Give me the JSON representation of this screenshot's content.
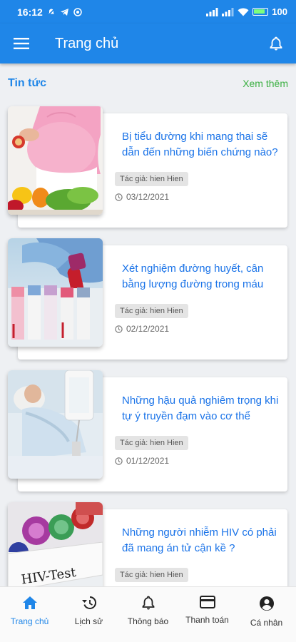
{
  "status_bar": {
    "time": "16:12",
    "battery": "100"
  },
  "app_bar": {
    "title": "Trang chủ"
  },
  "section": {
    "title": "Tin tức",
    "see_more": "Xem thêm"
  },
  "articles": [
    {
      "title": "Bị tiểu đường khi mang thai sẽ dẫn đến những biến chứng nào?",
      "author": "Tác giả: hien Hien",
      "date": "03/12/2021"
    },
    {
      "title": "Xét nghiệm đường huyết, cân bằng lượng đường trong máu",
      "author": "Tác giả: hien Hien",
      "date": "02/12/2021"
    },
    {
      "title": "Những hậu quả nghiêm trọng khi tự ý truyền đạm vào cơ thể",
      "author": "Tác giả: hien Hien",
      "date": "01/12/2021"
    },
    {
      "title": "Những người nhiễm HIV có phải đã mang án tử cận kề ?",
      "author": "Tác giả: hien Hien",
      "date": ""
    }
  ],
  "image_text": {
    "hiv_label": "HIV-Test"
  },
  "bottom_nav": [
    {
      "label": "Trang chủ",
      "icon": "home-icon",
      "active": true
    },
    {
      "label": "Lịch sử",
      "icon": "history-icon",
      "active": false
    },
    {
      "label": "Thông báo",
      "icon": "bell-icon",
      "active": false
    },
    {
      "label": "Thanh toán",
      "icon": "card-icon",
      "active": false
    },
    {
      "label": "Cá nhân",
      "icon": "account-icon",
      "active": false
    }
  ],
  "colors": {
    "primary": "#1f86e8",
    "see_more": "#3cb043",
    "title_link": "#1a73e8"
  }
}
